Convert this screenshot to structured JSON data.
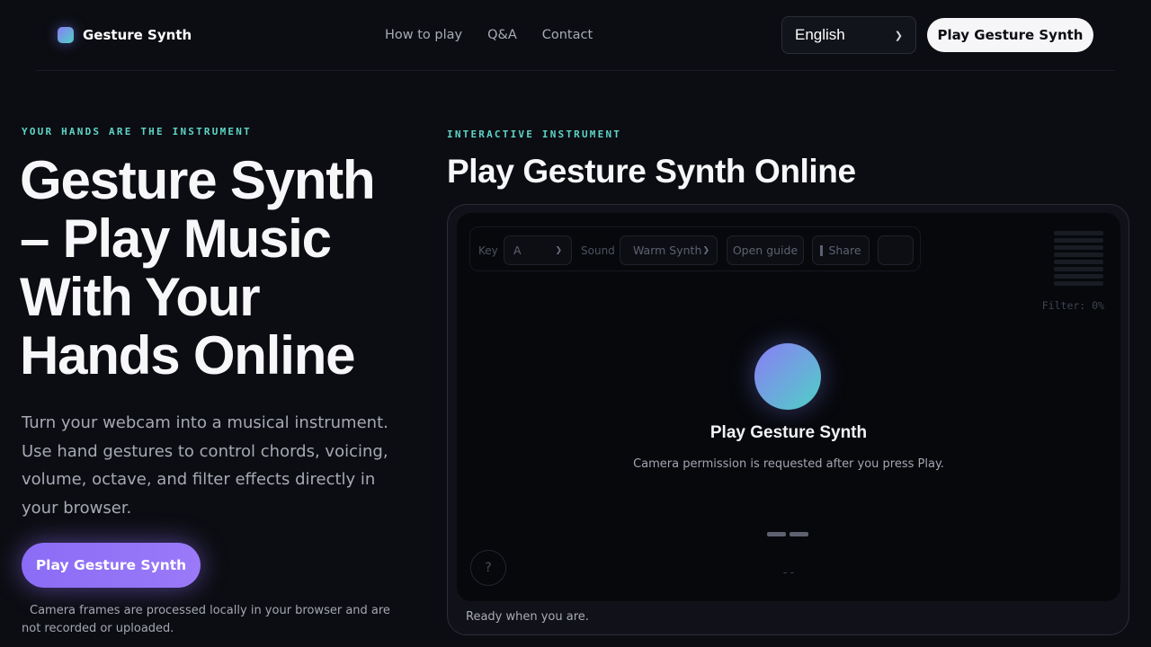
{
  "header": {
    "brand_name": "Gesture Synth",
    "nav": [
      "How to play",
      "Q&A",
      "Contact"
    ],
    "language": "English",
    "cta_label": "Play Gesture Synth"
  },
  "hero": {
    "eyebrow": "YOUR HANDS ARE THE INSTRUMENT",
    "title": "Gesture Synth – Play Music With Your Hands Online",
    "description": "Turn your webcam into a musical instrument. Use hand gestures to control chords, voicing, volume, octave, and filter effects directly in your browser.",
    "cta_label": "Play Gesture Synth",
    "privacy_note": "Camera frames are processed locally in your browser and are not recorded or uploaded."
  },
  "instrument": {
    "eyebrow": "INTERACTIVE INSTRUMENT",
    "title": "Play Gesture Synth Online",
    "toolbar": {
      "key_label": "Key",
      "key_value": "A",
      "sound_label": "Sound",
      "sound_value": "Warm Synth",
      "guide_label": "Open guide",
      "share_label": "Share"
    },
    "filter_readout": "Filter: 0%",
    "play_heading": "Play Gesture Synth",
    "play_sub": "Camera permission is requested after you press Play.",
    "help_label": "?",
    "value_readout": "--",
    "status": "Ready when you are."
  },
  "colors": {
    "background": "#0c0d12",
    "accent_purple": "#8b6cf6",
    "accent_teal": "#5ed4c8"
  }
}
